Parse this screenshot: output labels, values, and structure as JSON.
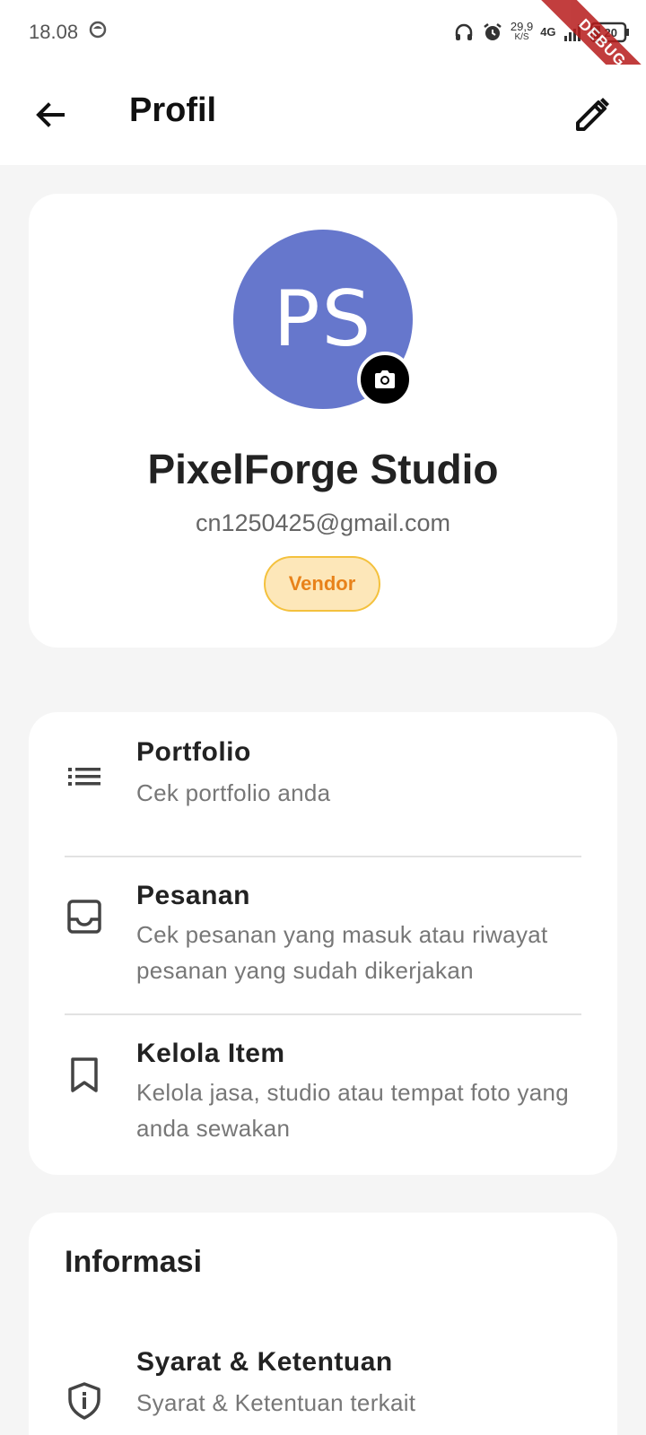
{
  "status_bar": {
    "time": "18.08",
    "net_speed_value": "29,9",
    "net_speed_unit": "K/S",
    "network_type": "4G",
    "battery": "20"
  },
  "debug_banner": "DEBUG",
  "app_bar": {
    "title": "Profil",
    "back_icon": "arrow-back-icon",
    "edit_icon": "pencil-edit-icon"
  },
  "profile": {
    "initials": "PS",
    "name": "PixelForge Studio",
    "email": "cn1250425@gmail.com",
    "role": "Vendor",
    "avatar_color": "#6677cc",
    "badge_bg": "#fde7b9",
    "badge_border": "#f4c13d",
    "badge_text_color": "#e8821a"
  },
  "menu": [
    {
      "icon": "list-icon",
      "title": "Portfolio",
      "subtitle": "Cek portfolio anda"
    },
    {
      "icon": "inbox-icon",
      "title": "Pesanan",
      "subtitle": "Cek pesanan yang masuk atau riwayat pesanan yang sudah dikerjakan"
    },
    {
      "icon": "bookmark-icon",
      "title": "Kelola Item",
      "subtitle": "Kelola jasa, studio atau tempat foto yang anda sewakan"
    }
  ],
  "info": {
    "title": "Informasi",
    "items": [
      {
        "icon": "shield-info-icon",
        "title": "Syarat & Ketentuan",
        "subtitle": "Syarat & Ketentuan terkait"
      }
    ]
  }
}
